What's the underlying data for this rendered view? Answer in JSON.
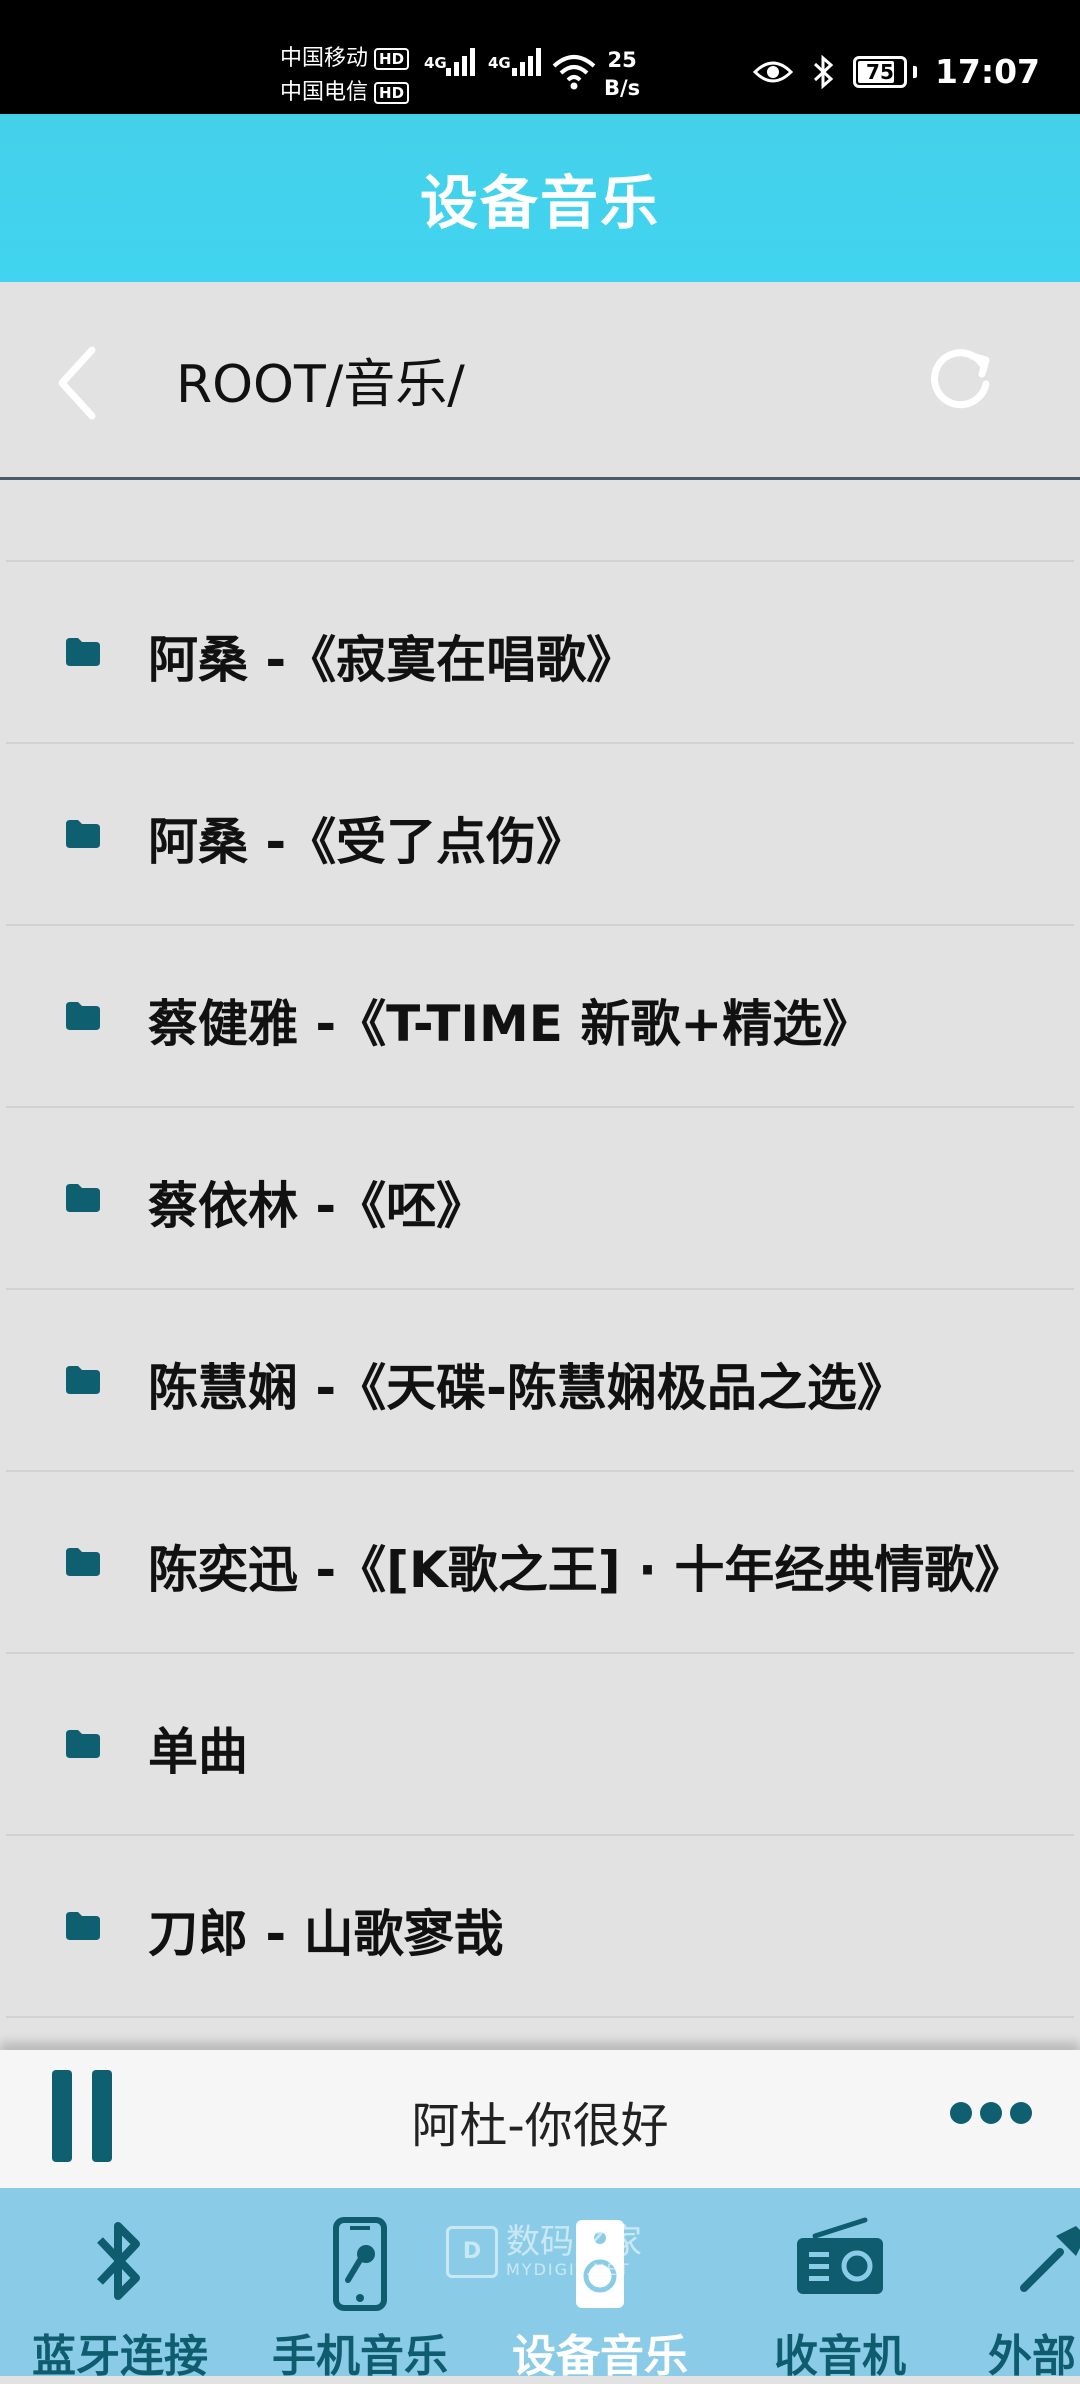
{
  "status_bar": {
    "carrier1": "中国移动",
    "carrier2": "中国电信",
    "hd": "HD",
    "net_type": "4G",
    "speed_value": "25",
    "speed_unit": "B/s",
    "battery": "75",
    "time": "17:07"
  },
  "header": {
    "title": "设备音乐"
  },
  "path_bar": {
    "path": "ROOT/音乐/"
  },
  "list": {
    "items": [
      {
        "label": "阿桑 -《寂寞在唱歌》"
      },
      {
        "label": "阿桑 -《受了点伤》"
      },
      {
        "label": "蔡健雅 -《T-TIME 新歌+精选》"
      },
      {
        "label": "蔡依林 -《呸》"
      },
      {
        "label": "陈慧娴 -《天碟-陈慧娴极品之选》"
      },
      {
        "label": "陈奕迅 -《[K歌之王] · 十年经典情歌》"
      },
      {
        "label": "单曲"
      },
      {
        "label": "刀郎 - 山歌寥哉"
      }
    ]
  },
  "player": {
    "now_playing": "阿杜-你很好"
  },
  "bottom_nav": {
    "items": [
      {
        "label": "蓝牙连接",
        "icon": "bluetooth-icon"
      },
      {
        "label": "手机音乐",
        "icon": "phone-music-icon"
      },
      {
        "label": "设备音乐",
        "icon": "device-music-icon",
        "active": true
      },
      {
        "label": "收音机",
        "icon": "radio-icon"
      },
      {
        "label": "外部",
        "icon": "external-icon"
      }
    ]
  },
  "watermark": {
    "text": "数码之家",
    "sub": "MYDIGIT.NET"
  },
  "colors": {
    "accent": "#40d4f0",
    "nav_bg": "#8acce8",
    "icon_dark": "#0e5f70",
    "list_bg": "#e2e2e2"
  }
}
